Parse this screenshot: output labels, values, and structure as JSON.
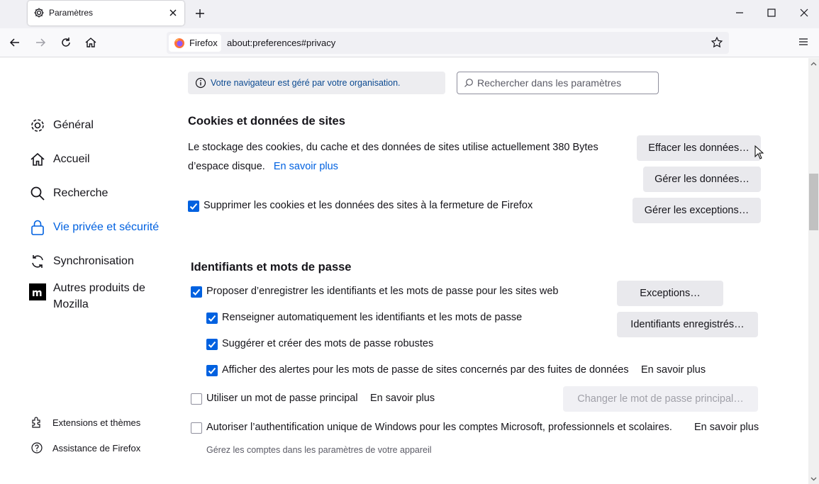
{
  "tab": {
    "title": "Paramètres"
  },
  "urlbar": {
    "identity": "Firefox",
    "url": "about:preferences#privacy"
  },
  "sidebar": {
    "items": [
      {
        "label": "Général",
        "icon": "gear-icon"
      },
      {
        "label": "Accueil",
        "icon": "home-icon"
      },
      {
        "label": "Recherche",
        "icon": "search-icon"
      },
      {
        "label": "Vie privée et sécurité",
        "icon": "lock-icon",
        "active": true
      },
      {
        "label": "Synchronisation",
        "icon": "sync-icon"
      },
      {
        "label": "Autres produits de Mozilla",
        "icon": "mozilla-icon"
      }
    ],
    "footer": [
      {
        "label": "Extensions et thèmes",
        "icon": "puzzle-icon"
      },
      {
        "label": "Assistance de Firefox",
        "icon": "help-icon"
      }
    ]
  },
  "managed_notice": "Votre navigateur est géré par votre organisation.",
  "search": {
    "placeholder": "Rechercher dans les paramètres"
  },
  "cookies": {
    "heading": "Cookies et données de sites",
    "description_line1": "Le stockage des cookies, du cache et des données de sites utilise actuellement 380 Bytes",
    "description_line2": "d’espace disque.",
    "learn_more": "En savoir plus",
    "clear_button": "Effacer les données…",
    "manage_button": "Gérer les données…",
    "exceptions_button": "Gérer les exceptions…",
    "delete_on_close": {
      "label": "Supprimer les cookies et les données des sites à la fermeture de Firefox",
      "checked": true
    }
  },
  "logins": {
    "heading": "Identifiants et mots de passe",
    "ask_to_save": {
      "label": "Proposer d’enregistrer les identifiants et les mots de passe pour les sites web",
      "checked": true
    },
    "autofill": {
      "label": "Renseigner automatiquement les identifiants et les mots de passe",
      "checked": true
    },
    "suggest": {
      "label": "Suggérer et créer des mots de passe robustes",
      "checked": true
    },
    "breach_alerts": {
      "label": "Afficher des alertes pour les mots de passe de sites concernés par des fuites de données",
      "checked": true
    },
    "breach_learn_more": "En savoir plus",
    "primary_password": {
      "label": "Utiliser un mot de passe principal",
      "checked": false
    },
    "primary_learn_more": "En savoir plus",
    "windows_sso": {
      "label": "Autoriser l’authentification unique de Windows pour les comptes Microsoft, professionnels et scolaires.",
      "checked": false
    },
    "sso_learn_more": "En savoir plus",
    "sso_hint": "Gérez les comptes dans les paramètres de votre appareil",
    "exceptions_button": "Exceptions…",
    "saved_logins_button": "Identifiants enregistrés…",
    "change_primary_button": "Changer le mot de passe principal…"
  },
  "colors": {
    "accent": "#0061e0",
    "button_bg": "#e9e9ed"
  }
}
